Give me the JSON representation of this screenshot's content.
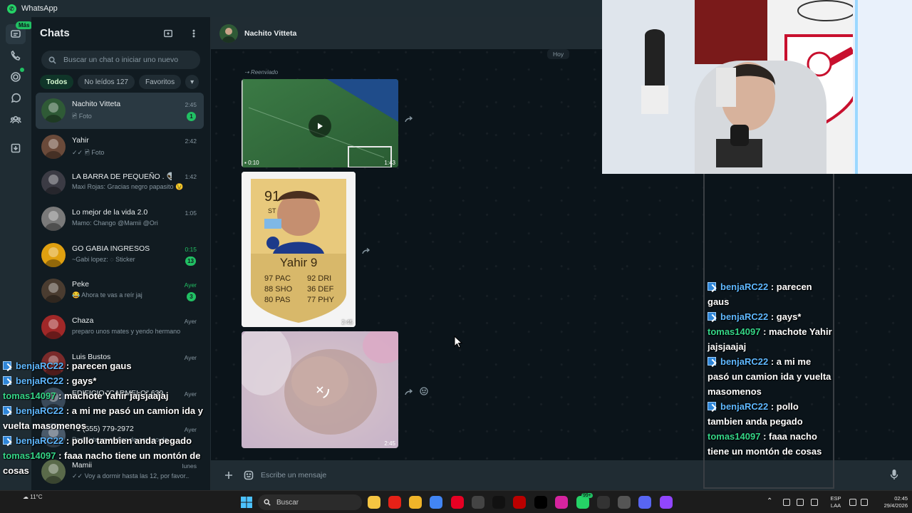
{
  "window": {
    "title": "WhatsApp"
  },
  "rail": {
    "mas_badge": "Más"
  },
  "chats": {
    "title": "Chats",
    "search_placeholder": "Buscar un chat o iniciar uno nuevo",
    "filters": [
      {
        "label": "Todos",
        "active": true
      },
      {
        "label": "No leídos 127",
        "active": false
      },
      {
        "label": "Favoritos",
        "active": false
      }
    ],
    "items": [
      {
        "name": "Nachito Vitteta",
        "preview": "🖻 Foto",
        "time": "2:45",
        "unread": "1",
        "time_green": false,
        "avatar_color": "#2f5a36"
      },
      {
        "name": "Yahir",
        "preview": "✓✓ 🖻 Foto",
        "time": "2:42",
        "unread": "",
        "time_green": false,
        "avatar_color": "#6a4a3a"
      },
      {
        "name": "LA BARRA DE PEQUEÑO . 👽",
        "preview": "Maxi Rojas: Gracias negro papasito 😉",
        "time": "1:42",
        "unread": "",
        "time_green": false,
        "avatar_color": "#3b3b44"
      },
      {
        "name": "Lo mejor de la vida 2.0",
        "preview": "Mamo: Chango @Mamii @Ori",
        "time": "1:05",
        "unread": "",
        "time_green": false,
        "avatar_color": "#7a7a7a"
      },
      {
        "name": "GO GABIA INGRESOS",
        "preview": "~Gabi lopez: ◌ Sticker",
        "time": "0:15",
        "unread": "13",
        "time_green": true,
        "avatar_color": "#e0a010"
      },
      {
        "name": "Peke",
        "preview": "😂 Ahora te vas a reír jaj",
        "time": "Ayer",
        "unread": "3",
        "time_green": true,
        "avatar_color": "#4a3c30"
      },
      {
        "name": "Chaza",
        "preview": "preparo unos mates y yendo hermano",
        "time": "Ayer",
        "unread": "",
        "time_green": false,
        "avatar_color": "#a02828"
      },
      {
        "name": "Luis Bustos",
        "preview": "",
        "time": "Ayer",
        "unread": "",
        "time_green": false,
        "avatar_color": "#7a2a2a"
      },
      {
        "name": "EDIFICIO \"CARMELO\" 639",
        "preview": "",
        "time": "Ayer",
        "unread": "",
        "time_green": false,
        "avatar_color": "#3a4a5a"
      },
      {
        "name": "+1 (555) 779-2972",
        "preview": "Recibiste un código de acceso de ...",
        "time": "Ayer",
        "unread": "",
        "time_green": false,
        "avatar_color": "#4a5a6a"
      },
      {
        "name": "Mamii",
        "preview": "✓✓ Voy a dormir hasta las 12, por favor...",
        "time": "lunes",
        "unread": "",
        "time_green": false,
        "avatar_color": "#5a6a4a"
      }
    ]
  },
  "conversation": {
    "contact_name": "Nachito Vitteta",
    "date_chip": "Hoy",
    "forwarded_label": "Reenviado",
    "video": {
      "duration": "0:10",
      "time": "1:43"
    },
    "card": {
      "rating": "91",
      "position": "ST",
      "name": "Yahir 9",
      "stats_left": [
        "97 PAC",
        "88 SHO",
        "80 PAS"
      ],
      "stats_right": [
        "92 DRI",
        "36 DEF",
        "77 PHY"
      ],
      "time": "2:45"
    },
    "photo": {
      "time": "2:45"
    },
    "composer_placeholder": "Escribe un mensaje"
  },
  "stream_chat": [
    {
      "user": "benjaRC22",
      "text": "parecen gaus",
      "badge": true,
      "color": "blue"
    },
    {
      "user": "benjaRC22",
      "text": "gays*",
      "badge": true,
      "color": "blue"
    },
    {
      "user": "tomas14097",
      "text": "machote Yahir jajsjaajaj",
      "badge": false,
      "color": "green"
    },
    {
      "user": "benjaRC22",
      "text": "a mi me pasó un camion ida y vuelta masomenos",
      "badge": true,
      "color": "blue"
    },
    {
      "user": "benjaRC22",
      "text": "pollo tambien anda pegado",
      "badge": true,
      "color": "blue"
    },
    {
      "user": "tomas14097",
      "text": "faaa nacho tiene un montón de cosas",
      "badge": false,
      "color": "green"
    }
  ],
  "taskbar": {
    "search_label": "Buscar",
    "weather": "11°C",
    "lang_top": "ESP",
    "lang_bottom": "LAA",
    "time": "02:45",
    "date": "29/4/2026",
    "whatsapp_badge": "99+"
  },
  "colors": {
    "accent": "#21c063",
    "panel_bg": "#111b21",
    "header_bg": "#202c33",
    "conv_bg": "#0b141a"
  }
}
